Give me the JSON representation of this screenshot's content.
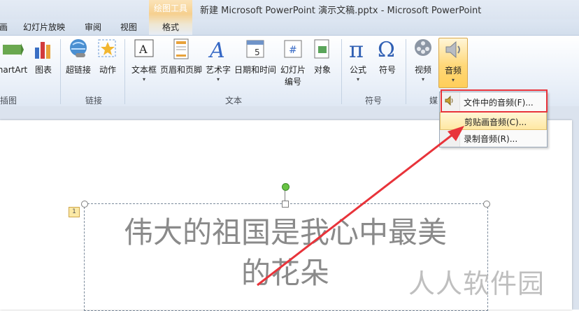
{
  "window": {
    "title": "新建 Microsoft PowerPoint 演示文稿.pptx - Microsoft PowerPoint",
    "context_group": "绘图工具"
  },
  "tabs": [
    "画",
    "幻灯片放映",
    "审阅",
    "视图",
    "格式"
  ],
  "ribbon": {
    "illustrations": {
      "smartart": "nartArt",
      "chart": "图表",
      "label": "插图"
    },
    "links": {
      "hyperlink": "超链接",
      "action": "动作",
      "label": "链接"
    },
    "text": {
      "textbox": "文本框",
      "header_footer": "页眉和页脚",
      "wordart": "艺术字",
      "datetime": "日期和时间",
      "slide_number": [
        "幻灯片",
        "编号"
      ],
      "object": "对象",
      "label": "文本"
    },
    "symbols": {
      "equation": "公式",
      "symbol": "符号",
      "label": "符号"
    },
    "media": {
      "video": "视频",
      "audio": "音频",
      "label": "媒"
    }
  },
  "audio_menu": {
    "items": [
      "文件中的音频(F)...",
      "剪贴画音频(C)...",
      "录制音频(R)..."
    ]
  },
  "slide": {
    "anim_tag": "1",
    "lines": [
      "伟大的祖国是我心中最美",
      "的花朵"
    ]
  },
  "watermark": "人人软件园",
  "colors": {
    "highlight_box": "#e8333a",
    "arrow": "#e8333a",
    "menu_hover": "#ffe8a3",
    "rotate_handle": "#68c344"
  }
}
